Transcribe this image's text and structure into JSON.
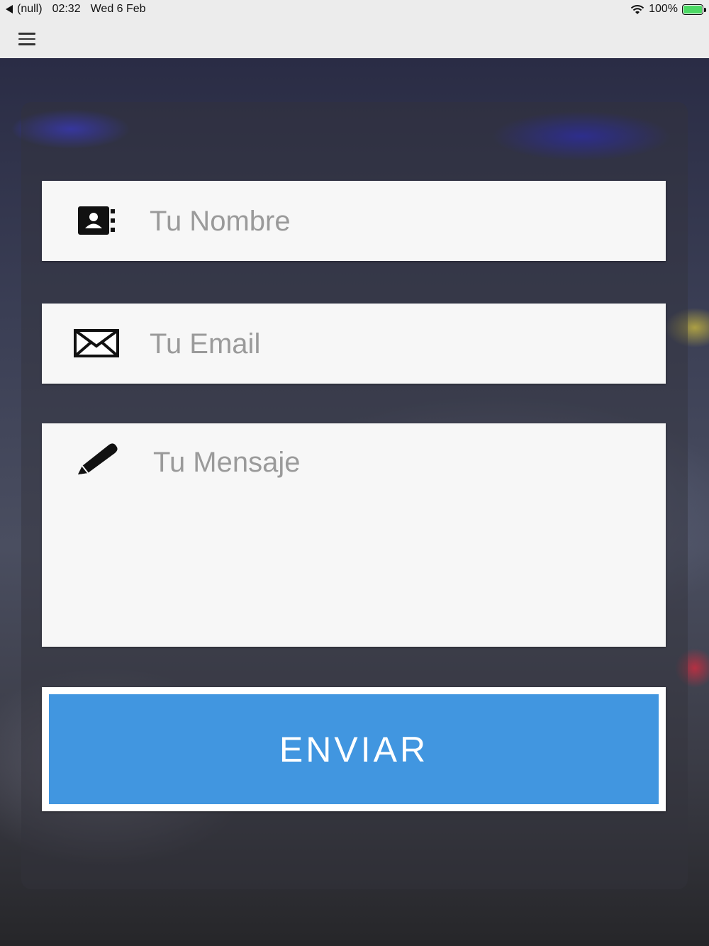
{
  "status_bar": {
    "back_label": "(null)",
    "time": "02:32",
    "date": "Wed 6 Feb",
    "battery": "100%"
  },
  "form": {
    "name": {
      "placeholder": "Tu Nombre",
      "value": ""
    },
    "email": {
      "placeholder": "Tu Email",
      "value": ""
    },
    "message": {
      "placeholder": "Tu Mensaje",
      "value": ""
    },
    "submit_label": "ENVIAR"
  },
  "colors": {
    "accent": "#4196e0",
    "field_bg": "#f7f7f7",
    "battery": "#4cd964"
  }
}
